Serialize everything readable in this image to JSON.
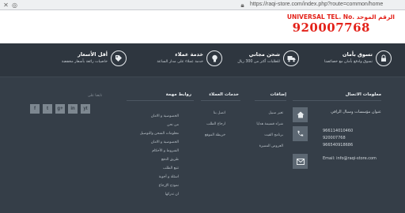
{
  "browser": {
    "url": "https://raqi-store.com/index.php?route=common/home"
  },
  "header": {
    "tel_label": "UNIVERSAL TEL. No. الرقم الموحد",
    "tel_number": "920007768"
  },
  "features": [
    {
      "title": "تسوق بأمان",
      "subtitle": "تسوق وادفع بأمان مع خصائصنا",
      "icon": "lock-icon"
    },
    {
      "title": "شحن مجاني",
      "subtitle": "للطلبات أكثر من 300 ريال",
      "icon": "truck-icon"
    },
    {
      "title": "خدمة عملاء",
      "subtitle": "خدمة عملاء على مدار الساعة",
      "icon": "lightbulb-icon"
    },
    {
      "title": "أقل الأسعار",
      "subtitle": "خاصيات رائعة بأسعار مخفضة",
      "icon": "tag-icon"
    }
  ],
  "footer": {
    "contact": {
      "title": "معلومات الاتصال",
      "address": "عنوان مؤسسات وسبال الراقي",
      "phones": [
        "966114010460",
        "920007768",
        "966540918686"
      ],
      "email": "Email: info@raqi-store.com"
    },
    "extras": {
      "title": "إضافات",
      "links": [
        "تغير سبيل",
        "شراء قسيمة هدايا",
        "برنامج القيت",
        "العروض المميزة"
      ]
    },
    "customer_service": {
      "title": "خدمات العملاء",
      "links": [
        "اتصل بنا",
        "ارجاع الطلب",
        "خريطة الموقع"
      ]
    },
    "important_links": {
      "title": "روابط مهمة",
      "follow_label": "تابعنا على",
      "links": [
        "الخصوصية و الامان",
        "من نحن",
        "معلومات الشحن والتوصيل",
        "الخصوصية و الامان",
        "الشروط و الأحكام",
        "طريق الدفع",
        "تتبع الطلب",
        "اسئلة و أجوبة",
        "نموذج الإرجاع",
        "ان تدركها"
      ]
    },
    "social": [
      "f",
      "t",
      "g+",
      "in",
      "yt"
    ]
  }
}
